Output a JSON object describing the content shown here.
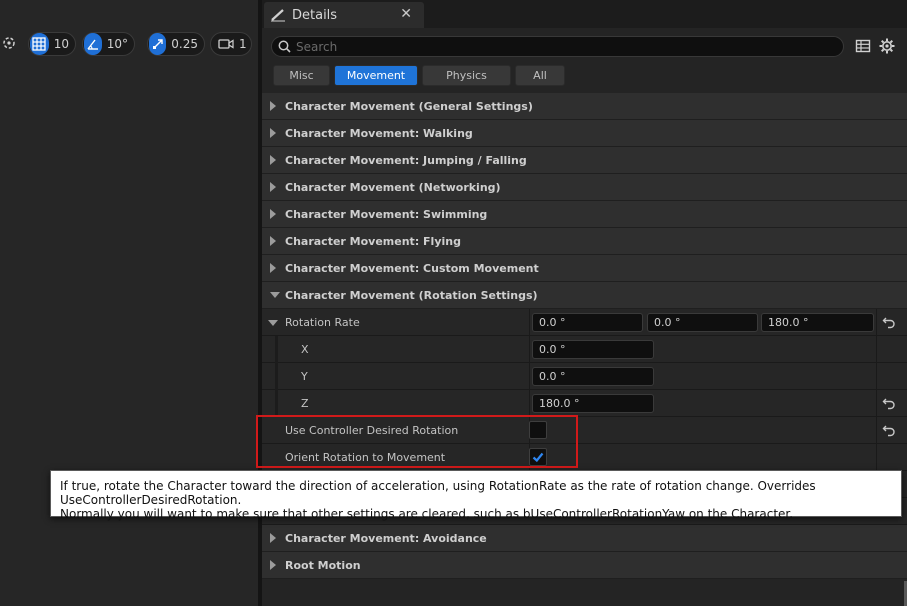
{
  "viewport_toolbar": {
    "grid_snap": "10",
    "rotation_snap": "10°",
    "scale_snap": "0.25",
    "camera_speed": "1"
  },
  "details": {
    "tab_title": "Details",
    "search_placeholder": "Search",
    "filters": [
      {
        "label": "Misc",
        "active": false
      },
      {
        "label": "Movement",
        "active": true
      },
      {
        "label": "Physics",
        "active": false
      },
      {
        "label": "All",
        "active": false
      }
    ],
    "categories_top": [
      "Character Movement (General Settings)",
      "Character Movement: Walking",
      "Character Movement: Jumping / Falling",
      "Character Movement (Networking)",
      "Character Movement: Swimming",
      "Character Movement: Flying",
      "Character Movement: Custom Movement"
    ],
    "rotation_category": "Character Movement (Rotation Settings)",
    "rotation_rate": {
      "label": "Rotation Rate",
      "x_val": "0.0 °",
      "y_val": "0.0 °",
      "z_val": "180.0 °",
      "x_label": "X",
      "y_label": "Y",
      "z_label": "Z"
    },
    "use_controller_desired_rotation": {
      "label": "Use Controller Desired Rotation",
      "checked": false
    },
    "orient_rotation_to_movement": {
      "label": "Orient Rotation to Movement",
      "checked": true
    },
    "categories_bottom": [
      "Character Movement: Avoidance",
      "Root Motion"
    ]
  },
  "tooltip": {
    "line1": "If true, rotate the Character toward the direction of acceleration, using RotationRate as the rate of rotation change. Overrides UseControllerDesiredRotation.",
    "line2": "Normally you will want to make sure that other settings are cleared, such as bUseControllerRotationYaw on the Character."
  },
  "colors": {
    "accent": "#1f74d8",
    "highlight_box": "#d11a1a"
  }
}
